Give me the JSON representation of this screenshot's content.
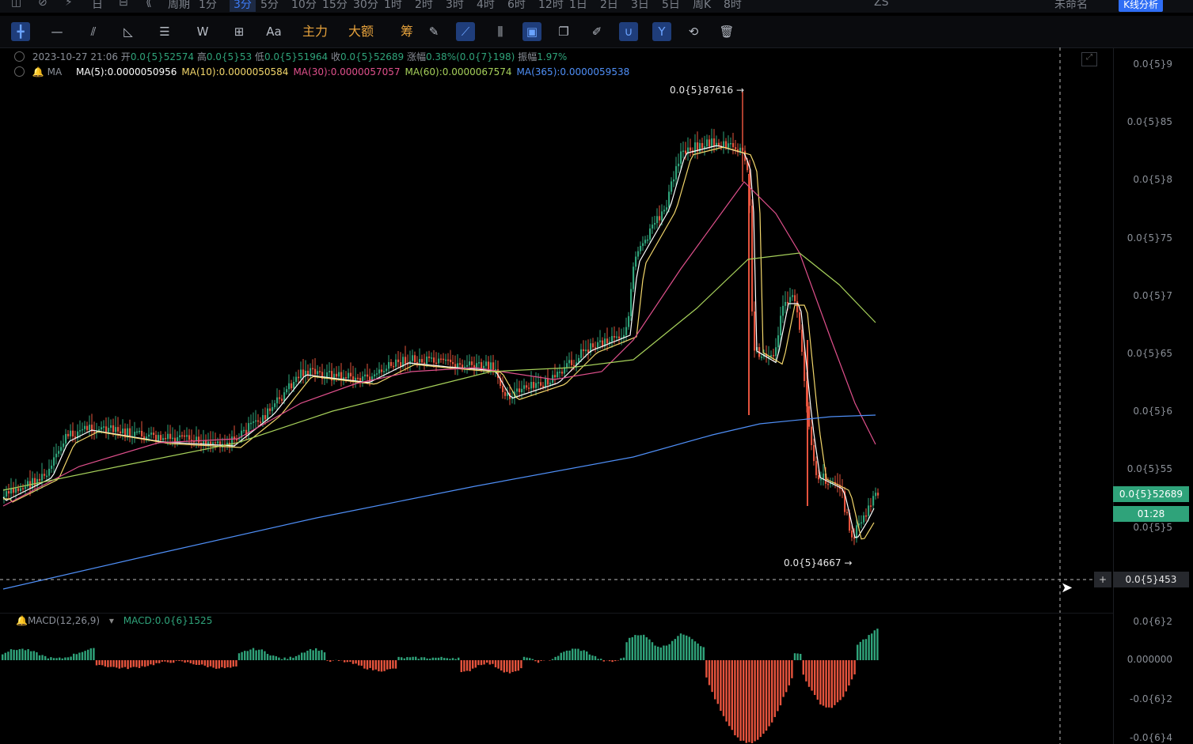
{
  "topbar": {
    "items": [
      "周期",
      "1分",
      "3分",
      "5分",
      "10分",
      "15分",
      "30分",
      "1时",
      "2时",
      "3时",
      "4时",
      "6时",
      "12时",
      "1日",
      "2日",
      "3日",
      "5日",
      "周K",
      "8时"
    ],
    "active": "3分",
    "right_items": [
      "ZS",
      "未命名"
    ],
    "kline_button": "K线分析"
  },
  "toolbar": {
    "tools": [
      {
        "icon": "crosshair-icon",
        "glyph": "╋",
        "selected": true
      },
      {
        "icon": "line-icon",
        "glyph": "—"
      },
      {
        "icon": "parallel-lines-icon",
        "glyph": "⫽"
      },
      {
        "icon": "angle-icon",
        "glyph": "◺"
      },
      {
        "icon": "horizontal-lines-icon",
        "glyph": "☰"
      },
      {
        "icon": "wave-icon",
        "glyph": "W"
      },
      {
        "icon": "measure-icon",
        "glyph": "⊞"
      },
      {
        "icon": "text-icon",
        "glyph": "Aa"
      },
      {
        "icon": "main-force-label",
        "glyph": "主力",
        "cn": true
      },
      {
        "icon": "large-amount-label",
        "glyph": "大额",
        "cn": true
      },
      {
        "icon": "chips-label",
        "glyph": "筹",
        "cn": true
      },
      {
        "icon": "ruler-icon",
        "glyph": "✎"
      },
      {
        "icon": "draw-mode-icon",
        "glyph": "⟋",
        "selected": true
      },
      {
        "icon": "candles-icon",
        "glyph": "⫼"
      },
      {
        "icon": "lock-icon",
        "glyph": "▣",
        "selected": true
      },
      {
        "icon": "copy-icon",
        "glyph": "❐"
      },
      {
        "icon": "edit-icon",
        "glyph": "✐"
      },
      {
        "icon": "magnet-icon",
        "glyph": "∪",
        "selected": true
      },
      {
        "icon": "filter-icon",
        "glyph": "Y",
        "selected": true
      },
      {
        "icon": "sync-icon",
        "glyph": "⟲"
      },
      {
        "icon": "trash-icon",
        "glyph": "🗑"
      }
    ]
  },
  "ohlc": {
    "date": "2023-10-27 21:06",
    "open_label": "开",
    "open": "0.0{5}52574",
    "high_label": "高",
    "high": "0.0{5}53",
    "low_label": "低",
    "low": "0.0{5}51964",
    "close_label": "收",
    "close": "0.0{5}52689",
    "change_label": "涨幅",
    "change": "0.38%(0.0{7}198)",
    "amp_label": "振幅",
    "amp": "1.97%"
  },
  "ma": {
    "label": "MA",
    "lines": [
      {
        "text": "MA(5):0.0000050956",
        "color": "#ffffff"
      },
      {
        "text": "MA(10):0.0000050584",
        "color": "#f3d76b"
      },
      {
        "text": "MA(30):0.0000057057",
        "color": "#e0508c"
      },
      {
        "text": "MA(60):0.0000067574",
        "color": "#a6d05a"
      },
      {
        "text": "MA(365):0.0000059538",
        "color": "#4f8ff7"
      }
    ]
  },
  "price_axis": [
    "0.0{5}9",
    "0.0{5}85",
    "0.0{5}8",
    "0.0{5}75",
    "0.0{5}7",
    "0.0{5}65",
    "0.0{5}6",
    "0.0{5}55",
    "0.0{5}5"
  ],
  "current_price": "0.0{5}52689",
  "countdown": "01:28",
  "crosshair_price": "0.0{5}453",
  "high_marker": "0.0{5}87616",
  "low_marker": "0.0{5}4667",
  "macd": {
    "label": "MACD(12,26,9)",
    "value": "MACD:0.0{6}1525",
    "axis": [
      "0.0{6}2",
      "0.000000",
      "-0.0{6}2",
      "-0.0{6}4"
    ]
  },
  "colors": {
    "up": "#2fa37a",
    "down": "#e5533d",
    "accent": "#2f6ef5"
  }
}
